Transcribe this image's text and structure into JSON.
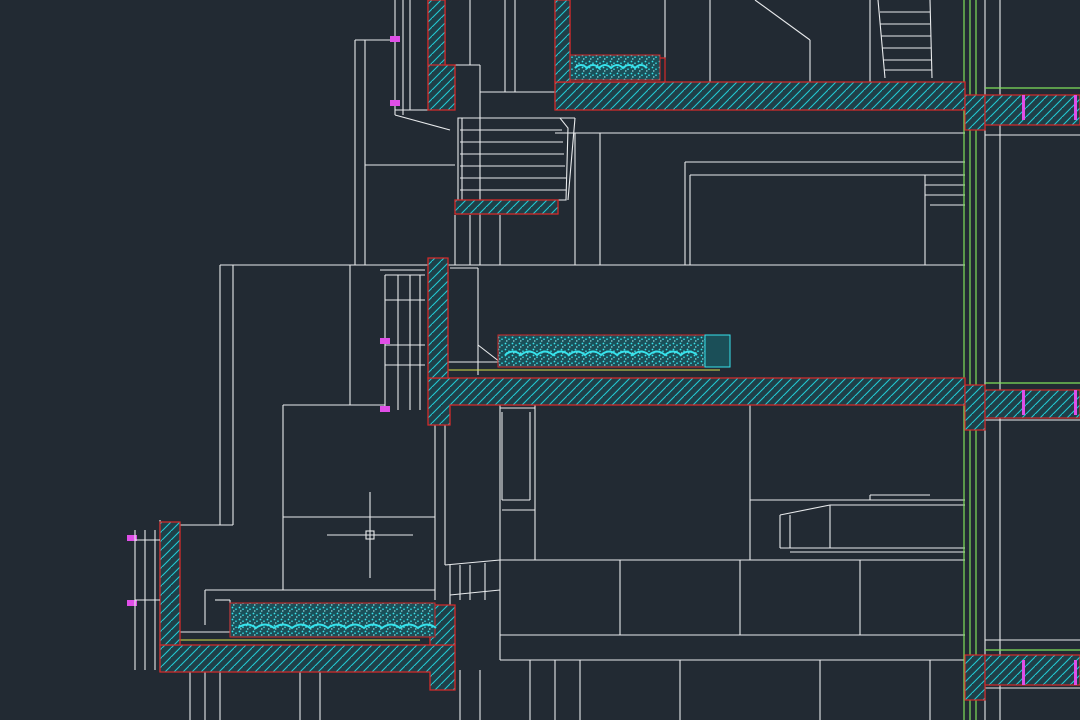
{
  "drawing": {
    "colors": {
      "background": "#222a33",
      "line": "#e8eaec",
      "section_outline": "#d42a2a",
      "hatch": "#22c8d2",
      "gravel": "#37e3ec",
      "glazing": "#7fe05a",
      "mullion": "#e04ee8",
      "railing": "#d8e04a"
    },
    "crosshair_cursor": true
  }
}
